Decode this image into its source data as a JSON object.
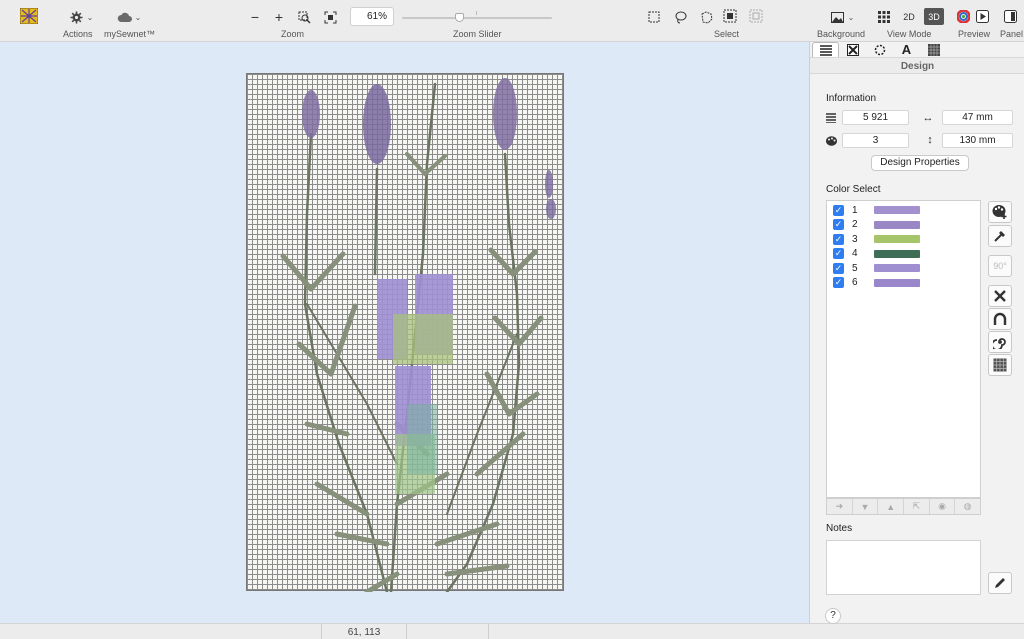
{
  "toolbar": {
    "actions_label": "Actions",
    "mysewnet_label": "mySewnet™",
    "zoom_label": "Zoom",
    "zoom_value": "61%",
    "zoom_slider_label": "Zoom Slider",
    "zoom_slider_level": 0.38,
    "select_label": "Select",
    "background_label": "Background",
    "view_mode_label": "View Mode",
    "view_2d": "2D",
    "view_3d": "3D",
    "preview_label": "Preview",
    "panel_label": "Panel"
  },
  "panel": {
    "tabs": [
      "design-info",
      "stitch-out",
      "circle",
      "text",
      "fill"
    ],
    "title": "Design",
    "information": {
      "heading": "Information",
      "stitches": "5 921",
      "width": "47 mm",
      "colors": "3",
      "height": "130 mm"
    },
    "design_properties_button": "Design Properties",
    "color_select": {
      "heading": "Color Select",
      "items": [
        {
          "num": "1",
          "color": "#a391cf",
          "checked": true
        },
        {
          "num": "2",
          "color": "#9a88c6",
          "checked": true
        },
        {
          "num": "3",
          "color": "#a6c46a",
          "checked": true
        },
        {
          "num": "4",
          "color": "#3f6e57",
          "checked": true
        },
        {
          "num": "5",
          "color": "#a08fd0",
          "checked": true
        },
        {
          "num": "6",
          "color": "#9a86ca",
          "checked": true
        }
      ]
    },
    "notes_heading": "Notes",
    "help": "?"
  },
  "status": {
    "coordinates": "61, 113"
  },
  "colors": {
    "canvas_bg": "#dde9f7",
    "accent_blue": "#2e7ef2",
    "lavender": "#8f78bf",
    "stem_green": "#7f8a6d"
  }
}
